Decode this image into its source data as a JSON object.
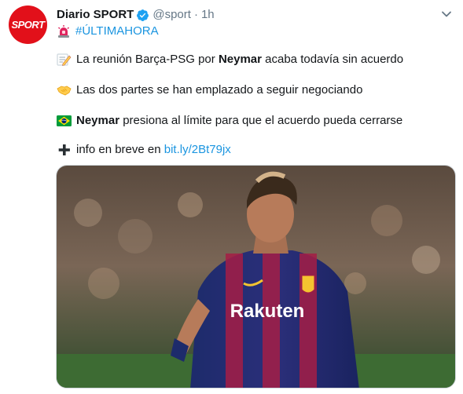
{
  "tweet": {
    "author_name": "Diario SPORT",
    "handle": "@sport",
    "separator": "·",
    "time": "1h",
    "avatar_label": "SPORT",
    "hashtag": "#ÚLTIMAHORA",
    "lines": [
      {
        "icon": "memo-pencil-icon",
        "pre": "La reunión Barça-PSG por ",
        "bold": "Neymar",
        "post": " acaba todavía sin acuerdo"
      },
      {
        "icon": "handshake-icon",
        "pre": "Las dos partes se han emplazado a seguir negociando",
        "bold": "",
        "post": ""
      },
      {
        "icon": "brazil-flag-icon",
        "pre": "",
        "bold": "Neymar",
        "post": " presiona al límite para que el acuerdo pueda cerrarse"
      },
      {
        "icon": "plus-icon",
        "pre": "info en breve en ",
        "link": "bit.ly/2Bt79jx"
      }
    ],
    "photo": {
      "shirt_text": "Rakuten"
    }
  },
  "colors": {
    "brand_red": "#e2101a",
    "link_blue": "#1b95e0",
    "muted": "#657786",
    "verified_blue": "#1da1f2"
  }
}
